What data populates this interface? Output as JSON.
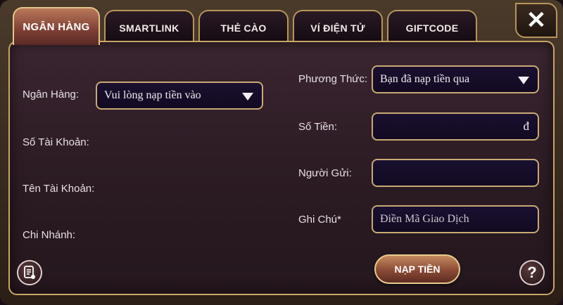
{
  "tabs": [
    {
      "label": "NGÂN HÀNG",
      "active": true
    },
    {
      "label": "SMARTLINK",
      "active": false
    },
    {
      "label": "THẺ CÀO",
      "active": false
    },
    {
      "label": "VÍ ĐIỆN TỬ",
      "active": false
    },
    {
      "label": "GIFTCODE",
      "active": false
    }
  ],
  "close_label": "✕",
  "left": {
    "bank_label": "Ngân Hàng:",
    "bank_select_value": "Vui lòng nạp tiền vào",
    "account_number_label": "Số Tài Khoản:",
    "account_name_label": "Tên Tài Khoản:",
    "branch_label": "Chi Nhánh:"
  },
  "right": {
    "method_label": "Phương Thức:",
    "method_select_value": "Bạn đã nạp tiền qua",
    "amount_label": "Số Tiền:",
    "amount_currency": "đ",
    "sender_label": "Người Gửi:",
    "note_label": "Ghi Chú*",
    "note_placeholder": "Điền Mã Giao Dịch"
  },
  "submit_label": "NẠP TIỀN",
  "help_label": "?",
  "colors": {
    "accent_gold": "#c9a568",
    "active_tab": "#9c5a44",
    "field_bg": "#150c28"
  }
}
